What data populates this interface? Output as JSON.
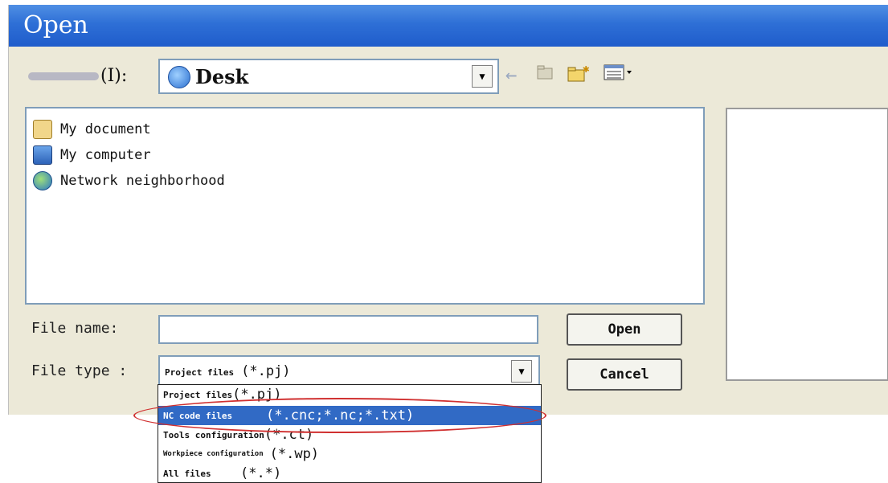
{
  "window": {
    "title": "Open"
  },
  "toolbar": {
    "look_in_label": "(I):",
    "location": "Desk",
    "icons": [
      "back-arrow-icon",
      "up-folder-icon",
      "new-folder-icon",
      "view-menu-icon"
    ]
  },
  "file_list": {
    "items": [
      {
        "name": "My document",
        "icon": "documents-folder-icon"
      },
      {
        "name": "My computer",
        "icon": "computer-icon"
      },
      {
        "name": "Network neighborhood",
        "icon": "network-icon"
      }
    ]
  },
  "form": {
    "file_name_label": "File name:",
    "file_name_value": "",
    "file_type_label": "File type :",
    "file_type_value_name": "Project files",
    "file_type_value_pattern": "(*.pj)"
  },
  "buttons": {
    "open": "Open",
    "cancel": "Cancel"
  },
  "file_type_options": [
    {
      "name": "Project files",
      "pattern": "(*.pj)",
      "selected": false
    },
    {
      "name": "NC code files",
      "pattern": "(*.cnc;*.nc;*.txt)",
      "selected": true
    },
    {
      "name": "Tools configuration",
      "pattern": "(*.ct)",
      "selected": false
    },
    {
      "name": "Workpiece configuration",
      "pattern": "(*.wp)",
      "selected": false
    },
    {
      "name": "All files",
      "pattern": "(*.*)",
      "selected": false
    }
  ],
  "colors": {
    "titlebar": "#2e6fd6",
    "selection": "#316ac5",
    "annotation": "#d03030",
    "dialog_bg": "#ece9d8"
  }
}
